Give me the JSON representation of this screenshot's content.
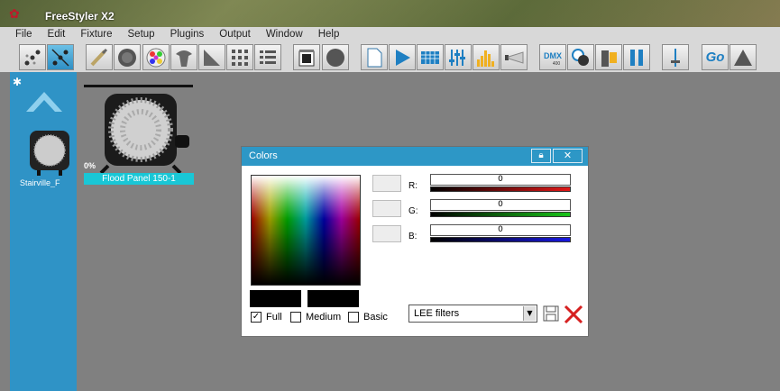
{
  "app": {
    "title": "FreeStyler X2",
    "logo_icon": "freestyler-logo-icon"
  },
  "menu": [
    "File",
    "Edit",
    "Fixture",
    "Setup",
    "Plugins",
    "Output",
    "Window",
    "Help"
  ],
  "toolbar": {
    "buttons": [
      "dots-icon",
      "link-icon",
      "brush-icon",
      "gobo-icon",
      "color-wheel-icon",
      "shutter-icon",
      "ramp-icon",
      "grid-icon",
      "list-icon",
      "scene-icon",
      "circle-icon",
      "page-icon",
      "play-icon",
      "matrix-icon",
      "faders-icon",
      "equalizer-icon",
      "beam-icon",
      "dmx-icon",
      "fog-icon",
      "pillar-icon",
      "pause-icon",
      "master-fader-icon",
      "go-icon",
      "triangle-icon"
    ],
    "dmx_label": "DMX",
    "dmx_sub": "400",
    "go_label": "Go"
  },
  "sidebar": {
    "fixture_label": "Stairville_F"
  },
  "fixture": {
    "percent": "0%",
    "label": "Flood Panel 150-1"
  },
  "dialog": {
    "title": "Colors",
    "channels": [
      {
        "label": "R:",
        "value": "0",
        "color": "#cc1111"
      },
      {
        "label": "G:",
        "value": "0",
        "color": "#11aa11"
      },
      {
        "label": "B:",
        "value": "0",
        "color": "#1111cc"
      }
    ],
    "checkboxes": [
      {
        "label": "Full",
        "checked": true
      },
      {
        "label": "Medium",
        "checked": false
      },
      {
        "label": "Basic",
        "checked": false
      }
    ],
    "filter_select": "LEE filters"
  },
  "colors": {
    "sidebar": "#2f93c6",
    "dialog_header": "#2d97c6",
    "fixture_label": "#19c7d6",
    "workspace": "#808080"
  }
}
